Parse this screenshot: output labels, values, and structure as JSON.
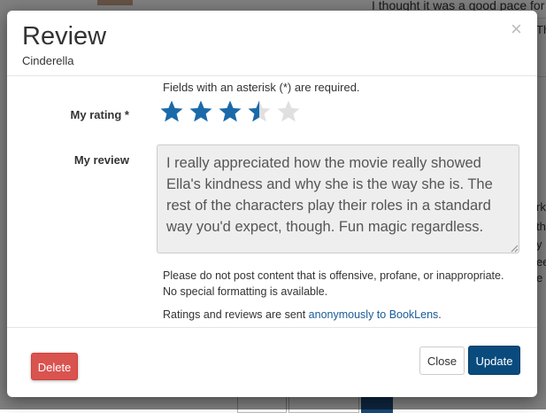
{
  "background": {
    "text_fragment": "I thought it was a good pace for",
    "side_fragments": [
      "Th",
      "rk",
      "th",
      "y",
      "ee",
      "e"
    ]
  },
  "modal": {
    "title": "Review",
    "subtitle": "Cinderella",
    "close_icon": "close-icon"
  },
  "form": {
    "required_note": "Fields with an asterisk (*) are required.",
    "rating_label": "My rating *",
    "rating": {
      "value": 3.5,
      "max": 5,
      "filled_color": "#1a6aaa",
      "empty_color": "#e0e0e0"
    },
    "review_label": "My review",
    "review_text": "I really appreciated how the movie really showed Ella's kindness and why she is the way she is. The rest of the characters play their roles in a standard way you'd expect, though. Fun magic regardless.",
    "content_note": "Please do not post content that is offensive, profane, or inappropriate. No special formatting is available.",
    "anon_note_prefix": "Ratings and reviews are sent ",
    "anon_note_link": "anonymously to BookLens",
    "anon_note_suffix": "."
  },
  "footer": {
    "delete_label": "Delete",
    "close_label": "Close",
    "update_label": "Update"
  },
  "colors": {
    "delete": "#d9534f",
    "update": "#0a4b7e",
    "link": "#1a5c96"
  }
}
